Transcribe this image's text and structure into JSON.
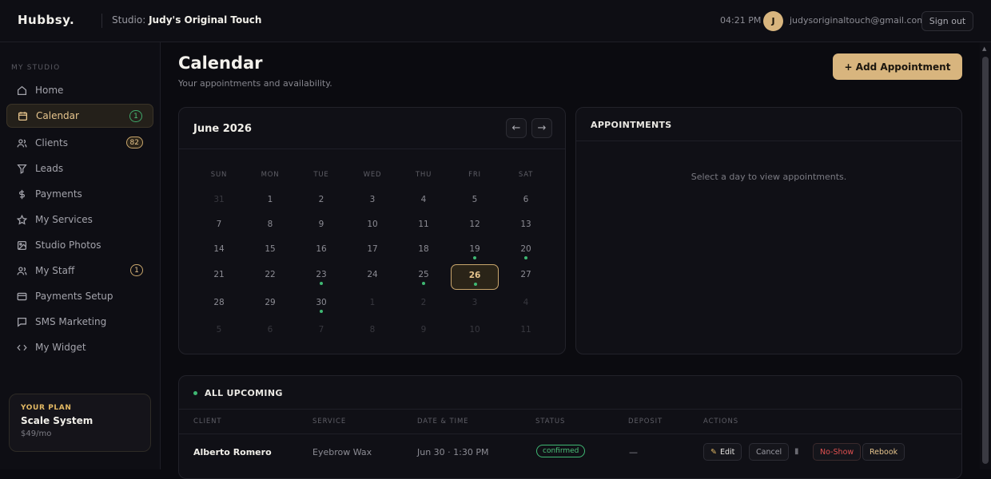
{
  "header": {
    "logo": "Hubbsy.",
    "studio_label": "Studio:",
    "studio_name": "Judy's Original Touch",
    "time": "04:21 PM",
    "avatar_initial": "J",
    "email": "judysoriginaltouch@gmail.com",
    "signout": "Sign out"
  },
  "sidebar": {
    "section": "MY STUDIO",
    "items": [
      {
        "label": "Home",
        "icon": "home-icon"
      },
      {
        "label": "Calendar",
        "icon": "calendar-icon",
        "badge": "1",
        "active": true
      },
      {
        "label": "Clients",
        "icon": "users-icon",
        "badge": "82"
      },
      {
        "label": "Leads",
        "icon": "filter-icon"
      },
      {
        "label": "Payments",
        "icon": "dollar-icon"
      },
      {
        "label": "My Services",
        "icon": "star-icon"
      },
      {
        "label": "Studio Photos",
        "icon": "image-icon"
      },
      {
        "label": "My Staff",
        "icon": "users-icon",
        "badge": "1"
      },
      {
        "label": "Payments Setup",
        "icon": "card-icon"
      },
      {
        "label": "SMS Marketing",
        "icon": "chat-icon"
      },
      {
        "label": "My Widget",
        "icon": "code-icon"
      }
    ],
    "plan": {
      "label": "YOUR PLAN",
      "name": "Scale System",
      "price": "$49/mo"
    }
  },
  "main": {
    "title": "Calendar",
    "subtitle": "Your appointments and availability.",
    "add_button": "+ Add Appointment"
  },
  "calendar": {
    "month": "June 2026",
    "prev": "←",
    "next": "→",
    "weekdays": [
      "SUN",
      "MON",
      "TUE",
      "WED",
      "THU",
      "FRI",
      "SAT"
    ],
    "weeks": [
      [
        {
          "d": "31",
          "m": true
        },
        {
          "d": "1"
        },
        {
          "d": "2"
        },
        {
          "d": "3"
        },
        {
          "d": "4"
        },
        {
          "d": "5"
        },
        {
          "d": "6"
        }
      ],
      [
        {
          "d": "7"
        },
        {
          "d": "8"
        },
        {
          "d": "9"
        },
        {
          "d": "10"
        },
        {
          "d": "11"
        },
        {
          "d": "12"
        },
        {
          "d": "13"
        }
      ],
      [
        {
          "d": "14"
        },
        {
          "d": "15"
        },
        {
          "d": "16"
        },
        {
          "d": "17"
        },
        {
          "d": "18"
        },
        {
          "d": "19",
          "dot": true
        },
        {
          "d": "20",
          "dot": true
        }
      ],
      [
        {
          "d": "21"
        },
        {
          "d": "22"
        },
        {
          "d": "23",
          "dot": true
        },
        {
          "d": "24"
        },
        {
          "d": "25",
          "dot": true
        },
        {
          "d": "26",
          "dot": true,
          "sel": true
        },
        {
          "d": "27"
        }
      ],
      [
        {
          "d": "28"
        },
        {
          "d": "29"
        },
        {
          "d": "30",
          "dot": true
        },
        {
          "d": "1",
          "m": true
        },
        {
          "d": "2",
          "m": true
        },
        {
          "d": "3",
          "m": true
        },
        {
          "d": "4",
          "m": true
        }
      ],
      [
        {
          "d": "5",
          "m": true
        },
        {
          "d": "6",
          "m": true
        },
        {
          "d": "7",
          "m": true
        },
        {
          "d": "8",
          "m": true
        },
        {
          "d": "9",
          "m": true
        },
        {
          "d": "10",
          "m": true
        },
        {
          "d": "11",
          "m": true
        }
      ]
    ]
  },
  "appointments": {
    "title": "APPOINTMENTS",
    "empty": "Select a day to view appointments."
  },
  "upcoming": {
    "title": "ALL UPCOMING",
    "columns": [
      "CLIENT",
      "SERVICE",
      "DATE & TIME",
      "STATUS",
      "DEPOSIT",
      "ACTIONS"
    ],
    "rows": [
      {
        "client": "Alberto Romero",
        "service": "Eyebrow Wax",
        "datetime": "Jun 30 · 1:30 PM",
        "status": "confirmed",
        "deposit": "—"
      }
    ],
    "actions": {
      "edit": "Edit",
      "cancel": "Cancel",
      "noshow": "No-Show",
      "rebook": "Rebook"
    }
  },
  "colors": {
    "accent": "#d8b57e",
    "success": "#3fb873",
    "danger": "#e05050",
    "bg": "#0b0b10"
  }
}
